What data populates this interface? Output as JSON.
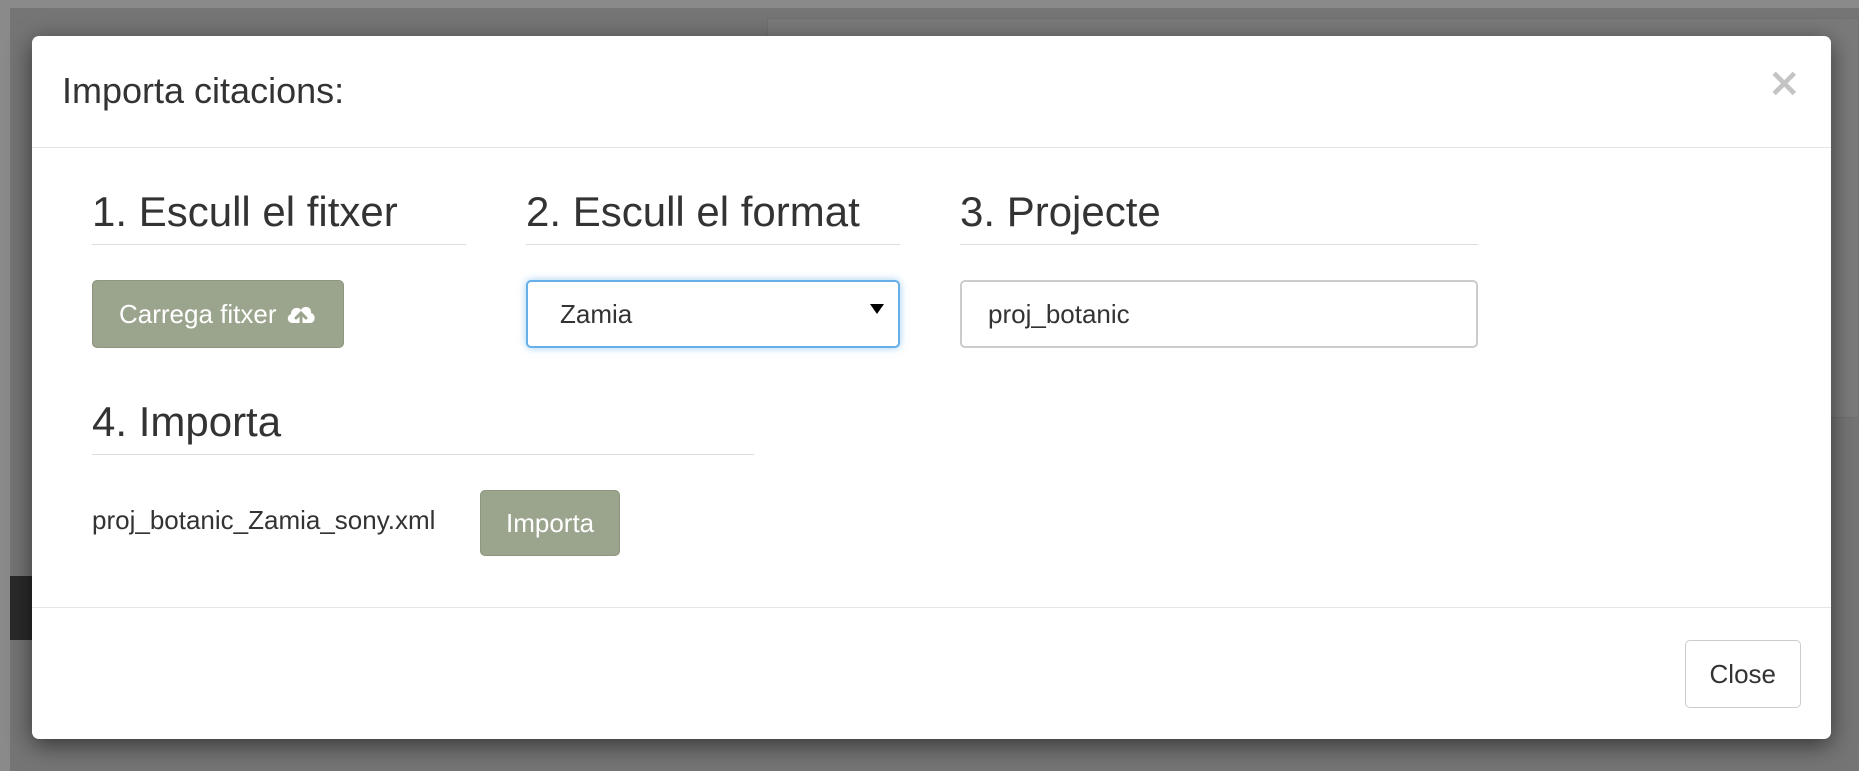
{
  "modal": {
    "title": "Importa citacions:",
    "close_symbol": "×"
  },
  "steps": {
    "file": {
      "heading": "1. Escull el fitxer",
      "upload_label": "Carrega fitxer",
      "upload_icon": "cloud-upload-icon"
    },
    "format": {
      "heading": "2. Escull el format",
      "selected": "Zamia"
    },
    "project": {
      "heading": "3. Projecte",
      "value": "proj_botanic"
    },
    "import": {
      "heading": "4. Importa",
      "filename": "proj_botanic_Zamia_sony.xml",
      "button_label": "Importa"
    }
  },
  "footer": {
    "close_label": "Close"
  },
  "colors": {
    "primary_button": "#9ba48d",
    "focus_border": "#66afe9",
    "overlay": "rgba(0,0,0,0.5)"
  }
}
